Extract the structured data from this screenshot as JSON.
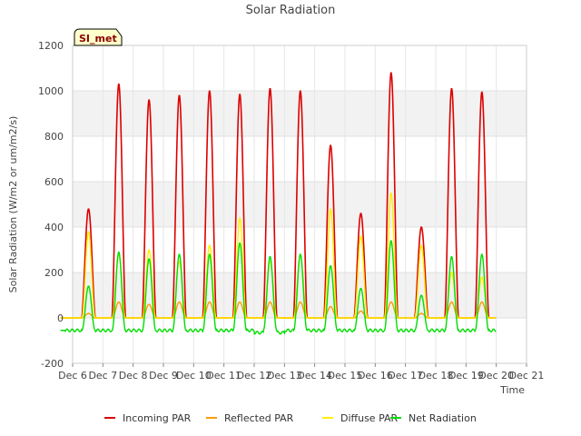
{
  "chart_data": {
    "type": "line",
    "title": "Solar Radiation",
    "xlabel": "Time",
    "ylabel": "Solar Radiation (W/m2 or um/m2/s)",
    "ylim": [
      -200,
      1200
    ],
    "yticks": [
      -200,
      0,
      200,
      400,
      600,
      800,
      1000,
      1200
    ],
    "xlim": [
      6,
      21
    ],
    "xticks": [
      {
        "v": 6,
        "label": "Dec 6"
      },
      {
        "v": 7,
        "label": "Dec 7"
      },
      {
        "v": 8,
        "label": "Dec 8"
      },
      {
        "v": 9,
        "label": "Dec 9"
      },
      {
        "v": 10,
        "label": "Dec 10"
      },
      {
        "v": 11,
        "label": "Dec 11"
      },
      {
        "v": 12,
        "label": "Dec 12"
      },
      {
        "v": 13,
        "label": "Dec 13"
      },
      {
        "v": 14,
        "label": "Dec 14"
      },
      {
        "v": 15,
        "label": "Dec 15"
      },
      {
        "v": 16,
        "label": "Dec 16"
      },
      {
        "v": 17,
        "label": "Dec 17"
      },
      {
        "v": 18,
        "label": "Dec 18"
      },
      {
        "v": 19,
        "label": "Dec 19"
      },
      {
        "v": 20,
        "label": "Dec 20"
      },
      {
        "v": 21,
        "label": "Dec 21"
      }
    ],
    "grid": true,
    "legend_position": "bottom",
    "station_label": "SI_met",
    "daily_peaks": [
      {
        "day": 6,
        "incoming": 480,
        "reflected": 20,
        "diffuse": 380,
        "net": 140
      },
      {
        "day": 7,
        "incoming": 1030,
        "reflected": 70,
        "diffuse": 280,
        "net": 290
      },
      {
        "day": 8,
        "incoming": 960,
        "reflected": 60,
        "diffuse": 300,
        "net": 260
      },
      {
        "day": 9,
        "incoming": 980,
        "reflected": 70,
        "diffuse": 250,
        "net": 280
      },
      {
        "day": 10,
        "incoming": 1000,
        "reflected": 70,
        "diffuse": 320,
        "net": 280
      },
      {
        "day": 11,
        "incoming": 985,
        "reflected": 70,
        "diffuse": 440,
        "net": 330
      },
      {
        "day": 12,
        "incoming": 1010,
        "reflected": 70,
        "diffuse": 250,
        "net": 270
      },
      {
        "day": 13,
        "incoming": 1000,
        "reflected": 70,
        "diffuse": 280,
        "net": 280
      },
      {
        "day": 14,
        "incoming": 760,
        "reflected": 50,
        "diffuse": 480,
        "net": 230
      },
      {
        "day": 15,
        "incoming": 460,
        "reflected": 30,
        "diffuse": 360,
        "net": 130
      },
      {
        "day": 16,
        "incoming": 1080,
        "reflected": 70,
        "diffuse": 550,
        "net": 340
      },
      {
        "day": 17,
        "incoming": 400,
        "reflected": 20,
        "diffuse": 320,
        "net": 100
      },
      {
        "day": 18,
        "incoming": 1010,
        "reflected": 70,
        "diffuse": 200,
        "net": 270
      },
      {
        "day": 19,
        "incoming": 995,
        "reflected": 70,
        "diffuse": 180,
        "net": 280
      }
    ],
    "night_net": -55,
    "series": [
      {
        "name": "Incoming PAR",
        "key": "incoming",
        "color": "#dd0000"
      },
      {
        "name": "Reflected PAR",
        "key": "reflected",
        "color": "#ff9900"
      },
      {
        "name": "Diffuse PAR",
        "key": "diffuse",
        "color": "#ffee00"
      },
      {
        "name": "Net Radiation",
        "key": "net",
        "color": "#00dd00"
      }
    ]
  }
}
